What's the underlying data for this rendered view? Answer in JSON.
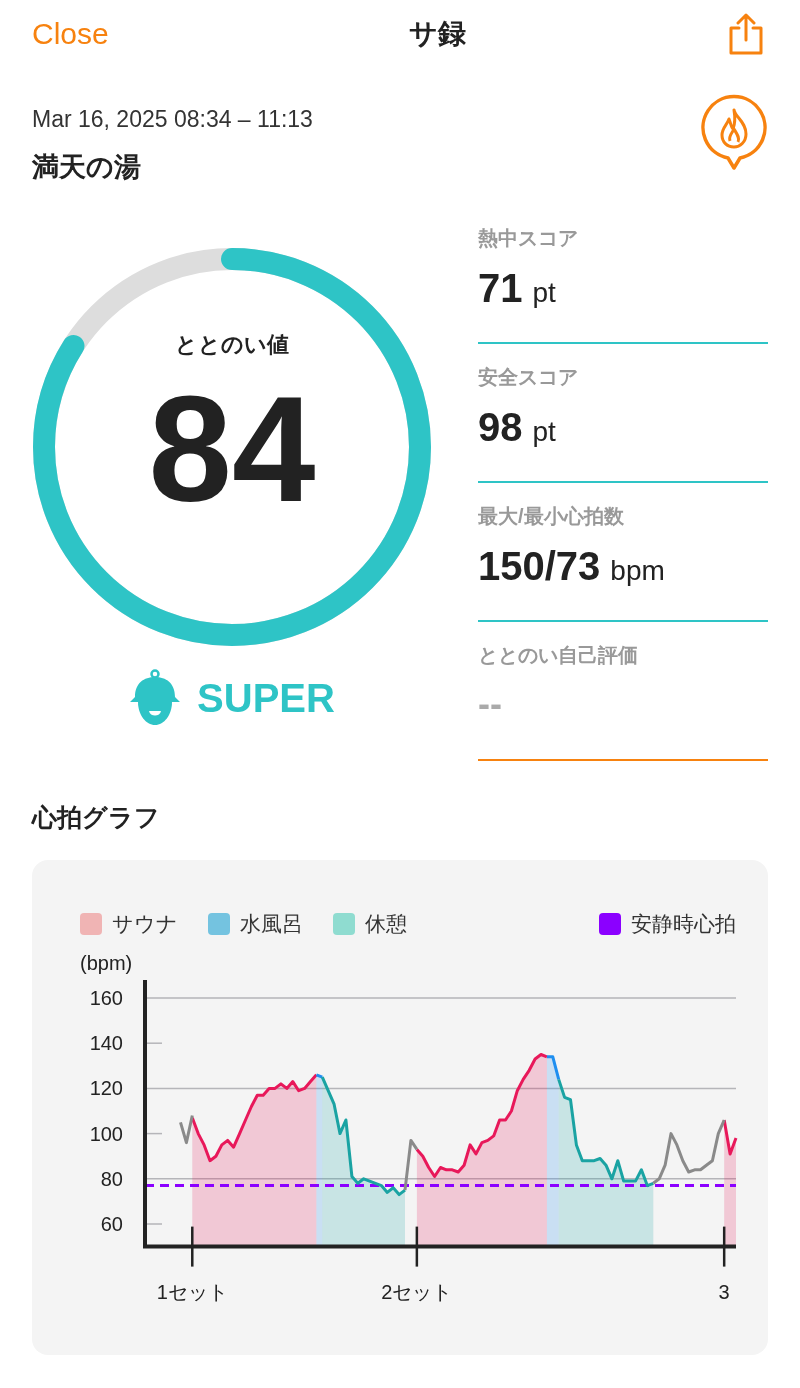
{
  "nav": {
    "close": "Close",
    "title": "サ録"
  },
  "session": {
    "datetime": "Mar 16, 2025 08:34 – 11:13",
    "place": "満天の湯"
  },
  "score": {
    "label": "ととのい値",
    "value": "84",
    "level": 0.84,
    "rank": "SUPER"
  },
  "stats": [
    {
      "kind": "score",
      "label": "熱中スコア",
      "value": "71",
      "unit": "pt"
    },
    {
      "kind": "score",
      "label": "安全スコア",
      "value": "98",
      "unit": "pt"
    },
    {
      "kind": "score",
      "label": "最大/最小心拍数",
      "value": "150/73",
      "unit": "bpm"
    },
    {
      "kind": "input",
      "label": "ととのい自己評価",
      "placeholder": "--"
    }
  ],
  "heart_graph": {
    "title": "心拍グラフ",
    "legend": [
      {
        "color": "#f0b4b4"
      },
      {
        "color": "#74c3e0"
      },
      {
        "color": "#8fdcd0"
      },
      {
        "color": "#8b00ff"
      }
    ],
    "chart_data": {
      "type": "area",
      "ylabel": "(bpm)",
      "ylim": [
        50,
        168
      ],
      "grid": true,
      "yticks": [
        60,
        80,
        100,
        120,
        140,
        160
      ],
      "categories": [
        null,
        null,
        null,
        null,
        null,
        null,
        null,
        null,
        "1セット",
        null,
        null,
        null,
        null,
        null,
        null,
        null,
        null,
        null,
        null,
        null,
        null,
        null,
        null,
        null,
        null,
        null,
        null,
        null,
        null,
        null,
        null,
        null,
        null,
        null,
        null,
        null,
        null,
        null,
        null,
        null,
        null,
        null,
        null,
        null,
        null,
        null,
        "2セット",
        null,
        null,
        null,
        null,
        null,
        null,
        null,
        null,
        null,
        null,
        null,
        null,
        null,
        null,
        null,
        null,
        null,
        null,
        null,
        null,
        null,
        null,
        null,
        null,
        null,
        null,
        null,
        null,
        null,
        null,
        null,
        null,
        null,
        null,
        null,
        null,
        null,
        null,
        null,
        null,
        null,
        null,
        null,
        null,
        null,
        null,
        null,
        null,
        null,
        null,
        null,
        "3",
        null,
        null
      ],
      "series": [
        {
          "name": "サウナ",
          "color": "#e8185a",
          "values": [
            null,
            null,
            null,
            null,
            null,
            null,
            null,
            null,
            107,
            100,
            95,
            88,
            90,
            95,
            97,
            94,
            100,
            106,
            112,
            117,
            117,
            120,
            120,
            122,
            120,
            123,
            119,
            120,
            123,
            126,
            null,
            null,
            null,
            null,
            null,
            null,
            null,
            null,
            null,
            null,
            null,
            null,
            null,
            null,
            null,
            null,
            93,
            90,
            85,
            81,
            85,
            84,
            84,
            83,
            86,
            95,
            91,
            96,
            97,
            99,
            106,
            106,
            110,
            119,
            124,
            128,
            133,
            135,
            134,
            null,
            null,
            null,
            null,
            null,
            null,
            null,
            null,
            null,
            null,
            null,
            null,
            null,
            null,
            null,
            null,
            null,
            null,
            null,
            null,
            null,
            null,
            null,
            null,
            null,
            null,
            null,
            null,
            null,
            106,
            91,
            98
          ]
        },
        {
          "name": "水風呂",
          "color": "#1e8ef0",
          "values": [
            null,
            null,
            null,
            null,
            null,
            null,
            null,
            null,
            null,
            null,
            null,
            null,
            null,
            null,
            null,
            null,
            null,
            null,
            null,
            null,
            null,
            null,
            null,
            null,
            null,
            null,
            null,
            null,
            null,
            126,
            125,
            null,
            null,
            null,
            null,
            null,
            null,
            null,
            null,
            null,
            null,
            null,
            null,
            null,
            null,
            null,
            null,
            null,
            null,
            null,
            null,
            null,
            null,
            null,
            null,
            null,
            null,
            null,
            null,
            null,
            null,
            null,
            null,
            null,
            null,
            null,
            null,
            null,
            134,
            134,
            124,
            null,
            null,
            null,
            null,
            null,
            null,
            null,
            null,
            null,
            null,
            null,
            null,
            null,
            null,
            null,
            null,
            null,
            null,
            null,
            null,
            null,
            null,
            null,
            null,
            null,
            null,
            null,
            null,
            null,
            null
          ]
        },
        {
          "name": "休憩",
          "color": "#1aa3a3",
          "values": [
            null,
            null,
            null,
            null,
            null,
            null,
            null,
            null,
            null,
            null,
            null,
            null,
            null,
            null,
            null,
            null,
            null,
            null,
            null,
            null,
            null,
            null,
            null,
            null,
            null,
            null,
            null,
            null,
            null,
            null,
            125,
            119,
            113,
            100,
            106,
            81,
            78,
            80,
            79,
            78,
            77,
            74,
            76,
            73,
            75,
            null,
            null,
            null,
            null,
            null,
            null,
            null,
            null,
            null,
            null,
            null,
            null,
            null,
            null,
            null,
            null,
            null,
            null,
            null,
            null,
            null,
            null,
            null,
            null,
            null,
            124,
            116,
            115,
            95,
            88,
            88,
            88,
            89,
            86,
            80,
            88,
            79,
            79,
            79,
            84,
            77,
            78,
            null,
            null,
            null,
            null,
            null,
            null,
            null,
            null,
            null,
            null,
            null,
            null,
            null,
            null
          ]
        },
        {
          "color": "#8a8a8a",
          "type": "line",
          "values": [
            null,
            null,
            null,
            null,
            null,
            null,
            105,
            96,
            108,
            null,
            null,
            null,
            null,
            null,
            null,
            null,
            null,
            null,
            null,
            null,
            null,
            null,
            null,
            null,
            null,
            null,
            null,
            null,
            null,
            null,
            null,
            null,
            null,
            null,
            null,
            null,
            null,
            null,
            null,
            null,
            null,
            null,
            null,
            null,
            75,
            97,
            93,
            null,
            null,
            null,
            null,
            null,
            null,
            null,
            null,
            null,
            null,
            null,
            null,
            null,
            null,
            null,
            null,
            null,
            null,
            null,
            null,
            null,
            null,
            null,
            null,
            null,
            null,
            null,
            null,
            null,
            null,
            null,
            null,
            null,
            null,
            null,
            null,
            null,
            null,
            null,
            78,
            80,
            86,
            100,
            95,
            88,
            83,
            84,
            84,
            86,
            88,
            100,
            106,
            null,
            null
          ]
        }
      ],
      "ref_lines": [
        {
          "axis": "y",
          "value": 77,
          "label": "安静時心拍"
        }
      ]
    }
  }
}
